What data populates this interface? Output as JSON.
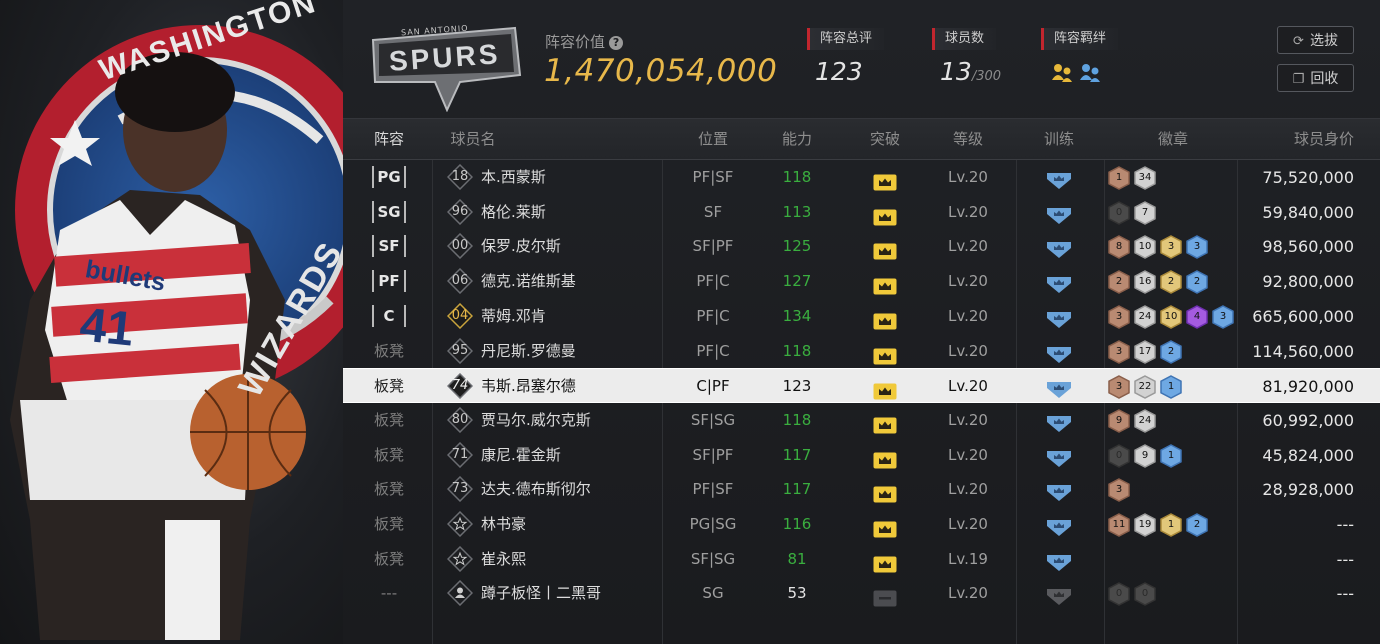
{
  "team": {
    "value_label": "阵容价值",
    "help_icon": "question-circle-icon",
    "value": "1,470,054,000",
    "rating_label": "阵容总评",
    "rating": "123",
    "player_count_label": "球员数",
    "player_count": "13",
    "player_cap": "/300",
    "bond_label": "阵容羁绊",
    "logo_text": "SPURS",
    "logo_small_text": "SAN ANTONIO"
  },
  "buttons": {
    "select_label": "选拔",
    "recycle_label": "回收"
  },
  "art": {
    "wordmark": "WASHINGTON",
    "wordmark2": "WIZARDS",
    "jersey_text": "bullets",
    "jersey_number": "41"
  },
  "columns": [
    "阵容",
    "球员名",
    "位置",
    "能力",
    "突破",
    "等级",
    "训练",
    "徽章",
    "球员身价"
  ],
  "colors": {
    "accent_gold": "#e8b84a",
    "ability_green": "#3aae3f",
    "tag_red": "#c2262e",
    "crown_yellow": "#f0c93a",
    "train_blue": "#6aa2d8"
  },
  "rows": [
    {
      "slot": "PG",
      "starter": true,
      "num": "18",
      "num_style": "dark",
      "name": "本.西蒙斯",
      "pos": "PF|SF",
      "ability": "118",
      "green": true,
      "breakthrough": "crown",
      "level": "Lv.20",
      "training": "blue",
      "badges": [
        {
          "c": "bronze",
          "n": "1"
        },
        {
          "c": "silver",
          "n": "34"
        }
      ],
      "price": "75,520,000"
    },
    {
      "slot": "SG",
      "starter": true,
      "num": "96",
      "num_style": "dark",
      "name": "格伦.莱斯",
      "pos": "SF",
      "ability": "113",
      "green": true,
      "breakthrough": "crown",
      "level": "Lv.20",
      "training": "blue",
      "badges": [
        {
          "c": "dim",
          "n": "0"
        },
        {
          "c": "silver",
          "n": "7"
        }
      ],
      "price": "59,840,000"
    },
    {
      "slot": "SF",
      "starter": true,
      "num": "00",
      "num_style": "dark",
      "name": "保罗.皮尔斯",
      "pos": "SF|PF",
      "ability": "125",
      "green": true,
      "breakthrough": "crown",
      "level": "Lv.20",
      "training": "blue",
      "badges": [
        {
          "c": "bronze",
          "n": "8"
        },
        {
          "c": "silver",
          "n": "10"
        },
        {
          "c": "gold",
          "n": "3"
        },
        {
          "c": "blue",
          "n": "3"
        }
      ],
      "price": "98,560,000"
    },
    {
      "slot": "PF",
      "starter": true,
      "num": "06",
      "num_style": "dark",
      "name": "德克.诺维斯基",
      "pos": "PF|C",
      "ability": "127",
      "green": true,
      "breakthrough": "crown",
      "level": "Lv.20",
      "training": "blue",
      "badges": [
        {
          "c": "bronze",
          "n": "2"
        },
        {
          "c": "silver",
          "n": "16"
        },
        {
          "c": "gold",
          "n": "2"
        },
        {
          "c": "blue",
          "n": "2"
        }
      ],
      "price": "92,800,000"
    },
    {
      "slot": "C",
      "starter": true,
      "num": "04",
      "num_style": "gold",
      "name": "蒂姆.邓肯",
      "pos": "PF|C",
      "ability": "134",
      "green": true,
      "breakthrough": "crown",
      "level": "Lv.20",
      "training": "blue",
      "badges": [
        {
          "c": "bronze",
          "n": "3"
        },
        {
          "c": "silver",
          "n": "24"
        },
        {
          "c": "gold",
          "n": "10"
        },
        {
          "c": "purple",
          "n": "4"
        },
        {
          "c": "blue",
          "n": "3"
        }
      ],
      "price": "665,600,000"
    },
    {
      "slot": "板凳",
      "starter": false,
      "num": "95",
      "num_style": "dark",
      "name": "丹尼斯.罗德曼",
      "pos": "PF|C",
      "ability": "118",
      "green": true,
      "breakthrough": "crown",
      "level": "Lv.20",
      "training": "blue",
      "badges": [
        {
          "c": "bronze",
          "n": "3"
        },
        {
          "c": "silver",
          "n": "17"
        },
        {
          "c": "blue",
          "n": "2"
        }
      ],
      "price": "114,560,000"
    },
    {
      "slot": "板凳",
      "starter": false,
      "selected": true,
      "num": "74",
      "num_style": "dark",
      "name": "韦斯.昂塞尔德",
      "pos": "C|PF",
      "ability": "123",
      "green": false,
      "breakthrough": "crown",
      "level": "Lv.20",
      "training": "blue",
      "badges": [
        {
          "c": "bronze",
          "n": "3"
        },
        {
          "c": "silver",
          "n": "22"
        },
        {
          "c": "blue",
          "n": "1"
        }
      ],
      "price": "81,920,000"
    },
    {
      "slot": "板凳",
      "starter": false,
      "num": "80",
      "num_style": "dark",
      "name": "贾马尔.威尔克斯",
      "pos": "SF|SG",
      "ability": "118",
      "green": true,
      "breakthrough": "crown",
      "level": "Lv.20",
      "training": "blue",
      "badges": [
        {
          "c": "bronze",
          "n": "9"
        },
        {
          "c": "silver",
          "n": "24"
        }
      ],
      "price": "60,992,000"
    },
    {
      "slot": "板凳",
      "starter": false,
      "num": "71",
      "num_style": "dark",
      "name": "康尼.霍金斯",
      "pos": "SF|PF",
      "ability": "117",
      "green": true,
      "breakthrough": "crown",
      "level": "Lv.20",
      "training": "blue",
      "badges": [
        {
          "c": "dim",
          "n": "0"
        },
        {
          "c": "silver",
          "n": "9"
        },
        {
          "c": "blue",
          "n": "1"
        }
      ],
      "price": "45,824,000"
    },
    {
      "slot": "板凳",
      "starter": false,
      "num": "73",
      "num_style": "dark",
      "name": "达夫.德布斯彻尔",
      "pos": "PF|SF",
      "ability": "117",
      "green": true,
      "breakthrough": "crown",
      "level": "Lv.20",
      "training": "blue",
      "badges": [
        {
          "c": "bronze",
          "n": "3"
        }
      ],
      "price": "28,928,000"
    },
    {
      "slot": "板凳",
      "starter": false,
      "num": "",
      "num_style": "star",
      "name": "林书豪",
      "pos": "PG|SG",
      "ability": "116",
      "green": true,
      "breakthrough": "crown",
      "level": "Lv.20",
      "training": "blue",
      "badges": [
        {
          "c": "bronze",
          "n": "11"
        },
        {
          "c": "silver",
          "n": "19"
        },
        {
          "c": "gold",
          "n": "1"
        },
        {
          "c": "blue",
          "n": "2"
        }
      ],
      "price": "---"
    },
    {
      "slot": "板凳",
      "starter": false,
      "num": "",
      "num_style": "star",
      "name": "崔永熙",
      "pos": "SF|SG",
      "ability": "81",
      "green": true,
      "breakthrough": "crown",
      "level": "Lv.19",
      "training": "blue",
      "badges": [],
      "price": "---"
    },
    {
      "slot": "---",
      "starter": false,
      "num": "",
      "num_style": "person",
      "name": "蹲子板怪丨二黑哥",
      "pos": "SG",
      "ability": "53",
      "green": false,
      "breakthrough": "gray",
      "level": "Lv.20",
      "training": "gray",
      "badges": [
        {
          "c": "dim",
          "n": "0"
        },
        {
          "c": "dim",
          "n": "0"
        }
      ],
      "price": "---"
    }
  ]
}
